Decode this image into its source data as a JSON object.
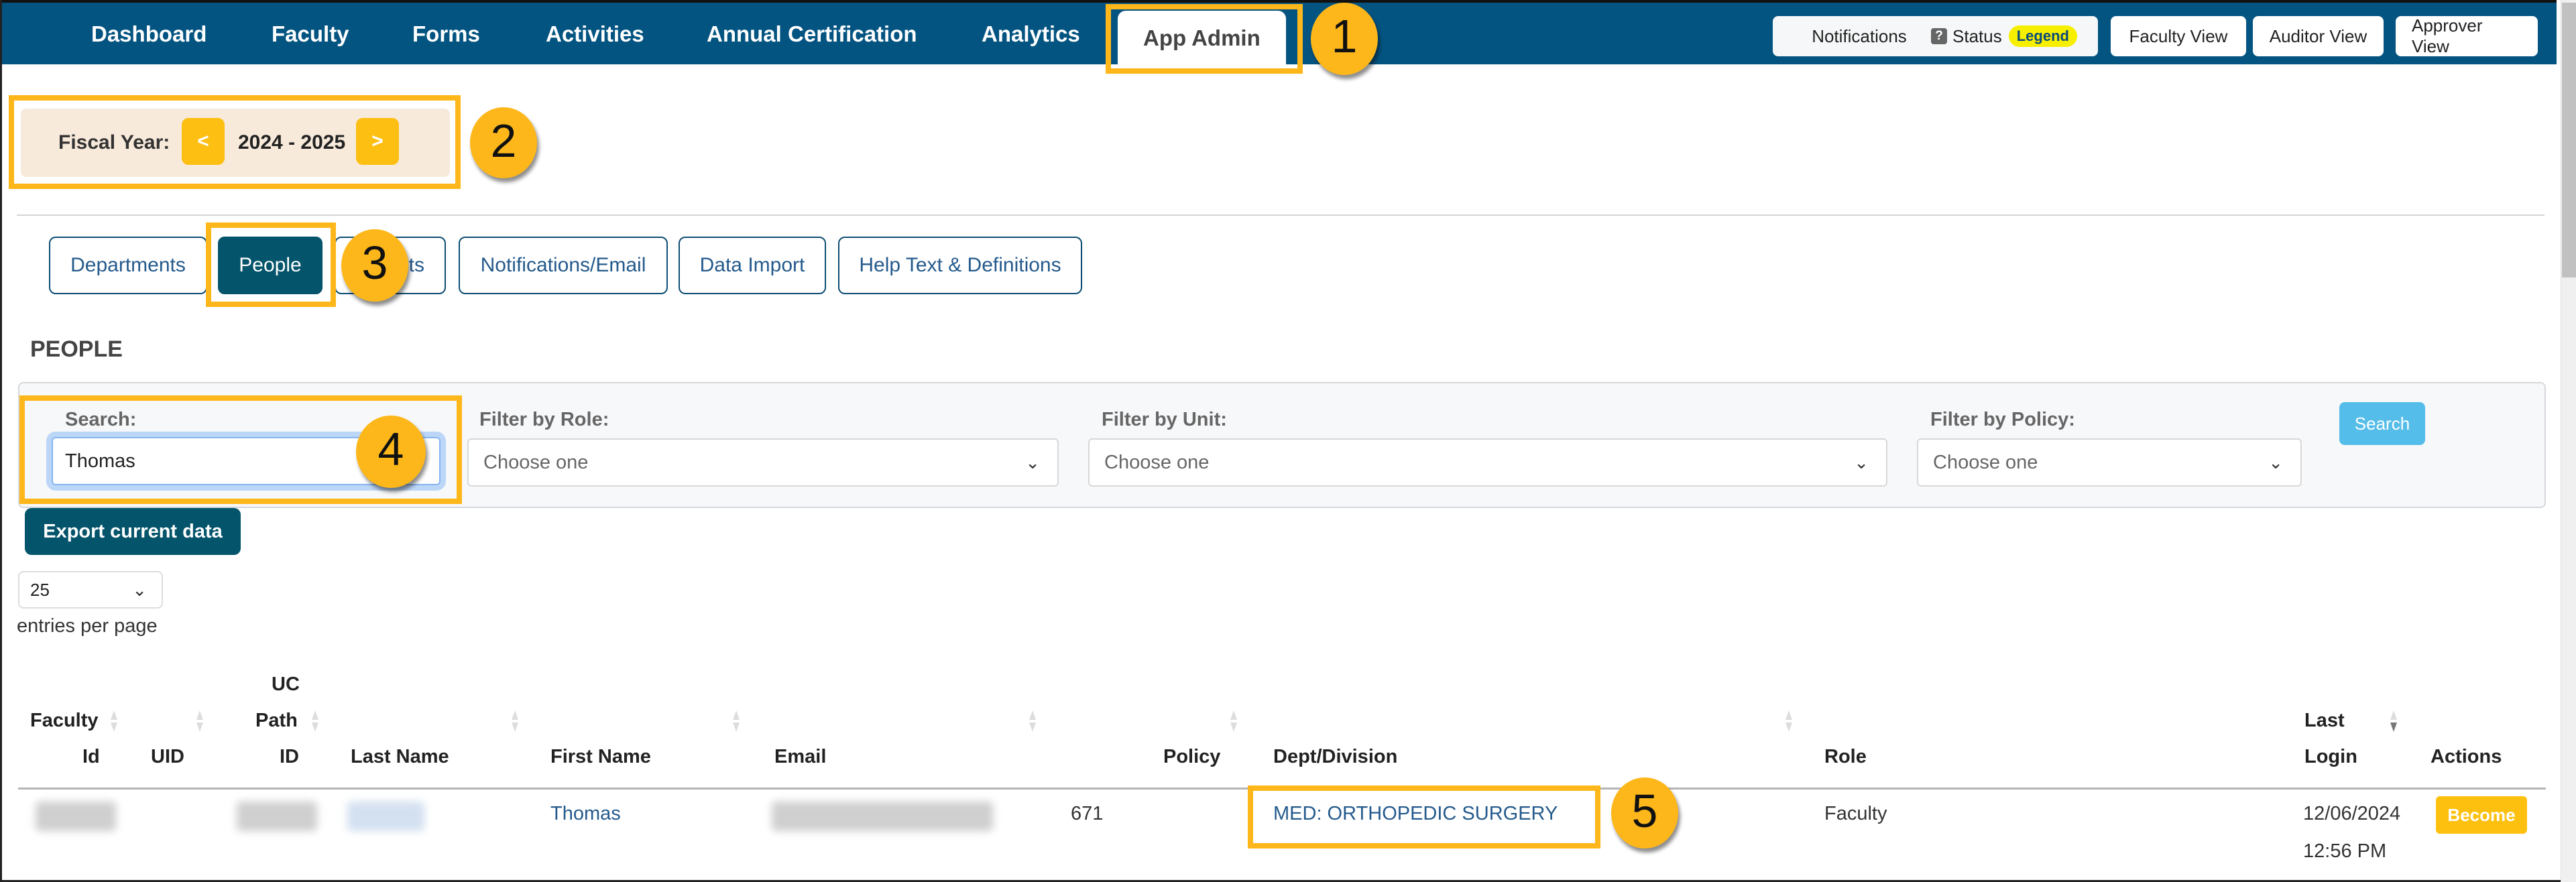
{
  "nav": {
    "items": [
      {
        "label": "Dashboard"
      },
      {
        "label": "Faculty"
      },
      {
        "label": "Forms"
      },
      {
        "label": "Activities"
      },
      {
        "label": "Annual Certification"
      },
      {
        "label": "Analytics"
      },
      {
        "label": "App Admin",
        "active": true
      }
    ],
    "right_buttons": {
      "notifications": "Notifications",
      "status": "Status",
      "status_icon": "?",
      "legend": "Legend",
      "faculty_view": "Faculty View",
      "auditor_view": "Auditor View",
      "approver_view": "Approver View"
    }
  },
  "fiscal_year": {
    "label": "Fiscal Year:",
    "prev": "<",
    "value": "2024 - 2025",
    "next": ">"
  },
  "admin_tabs": [
    {
      "label": "Departments"
    },
    {
      "label": "People",
      "active": true
    },
    {
      "label": "ts"
    },
    {
      "label": "Notifications/Email"
    },
    {
      "label": "Data Import"
    },
    {
      "label": "Help Text & Definitions"
    }
  ],
  "section_title": "PEOPLE",
  "filters": {
    "search_label": "Search:",
    "search_value": "Thomas",
    "role_label": "Filter by Role:",
    "role_value": "Choose one",
    "unit_label": "Filter by Unit:",
    "unit_value": "Choose one",
    "policy_label": "Filter by Policy:",
    "policy_value": "Choose one",
    "search_button": "Search"
  },
  "export_button": "Export current data",
  "entries": {
    "value": "25",
    "label": "entries per page"
  },
  "table": {
    "headers": {
      "faculty_id": [
        "Faculty",
        "Id"
      ],
      "uid": "UID",
      "uc_path_id": [
        "UC",
        "Path",
        "ID"
      ],
      "last_name": "Last Name",
      "first_name": "First Name",
      "email": "Email",
      "policy": "Policy",
      "dept": "Dept/Division",
      "role": "Role",
      "last_login": [
        "Last",
        "Login"
      ],
      "actions": "Actions"
    },
    "rows": [
      {
        "faculty_id": "[redacted]",
        "uid": "",
        "uc_path_id": "[redacted]",
        "last_name": "[redacted]",
        "first_name": "Thomas",
        "email": "[redacted]",
        "policy": "671",
        "dept": "MED: ORTHOPEDIC SURGERY",
        "role": "Faculty",
        "last_login_date": "12/06/2024",
        "last_login_time": "12:56 PM",
        "action": "Become"
      }
    ]
  },
  "callouts": [
    "1",
    "2",
    "3",
    "4",
    "5"
  ],
  "colors": {
    "nav_bg": "#045481",
    "accent_yellow": "#fdbf12",
    "callout": "#fdb71a",
    "primary_dark": "#04546b",
    "link": "#245a8c",
    "search_btn": "#55bde9"
  }
}
